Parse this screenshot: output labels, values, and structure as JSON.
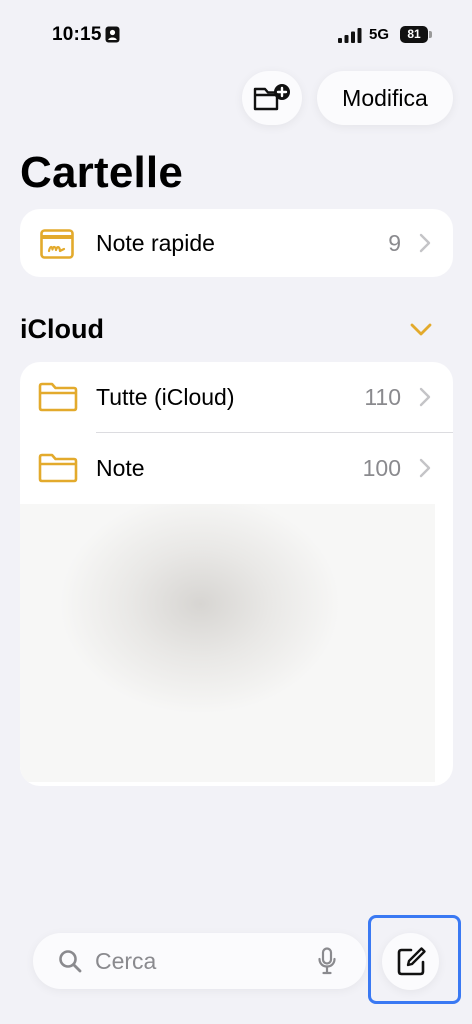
{
  "status_bar": {
    "time": "10:15",
    "network": "5G",
    "battery": "81"
  },
  "toolbar": {
    "new_folder_icon": "folder-badge-plus-icon",
    "edit_label": "Modifica"
  },
  "page": {
    "title": "Cartelle"
  },
  "quick_notes": {
    "label": "Note rapide",
    "count": "9",
    "icon": "quick-note-icon"
  },
  "icloud": {
    "title": "iCloud",
    "folders": [
      {
        "label": "Tutte (iCloud)",
        "count": "110",
        "icon": "folder-icon"
      },
      {
        "label": "Note",
        "count": "100",
        "icon": "folder-icon"
      }
    ]
  },
  "search": {
    "placeholder": "Cerca"
  },
  "colors": {
    "accent": "#e3aa2c",
    "background": "#f2f2f7",
    "highlight": "#3a79f3"
  }
}
